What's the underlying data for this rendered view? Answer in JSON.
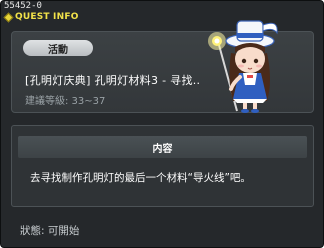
{
  "quest_id": "55452-0",
  "title": "QUEST INFO",
  "event_badge": "活動",
  "quest_name": "[孔明灯庆典] 孔明灯材料3 - 寻找..",
  "level_requirement": "建議等級: 33~37",
  "content_header": "内容",
  "content_text": "去寻找制作孔明灯的最后一个材料“导火线”吧。",
  "status": "狀態: 可開始",
  "colors": {
    "title_yellow": "#f2e24a",
    "window_bg": "#25282b",
    "panel_bg": "#33373a"
  },
  "icons": [
    "title-gem-icon",
    "npc-lantern-girl"
  ]
}
